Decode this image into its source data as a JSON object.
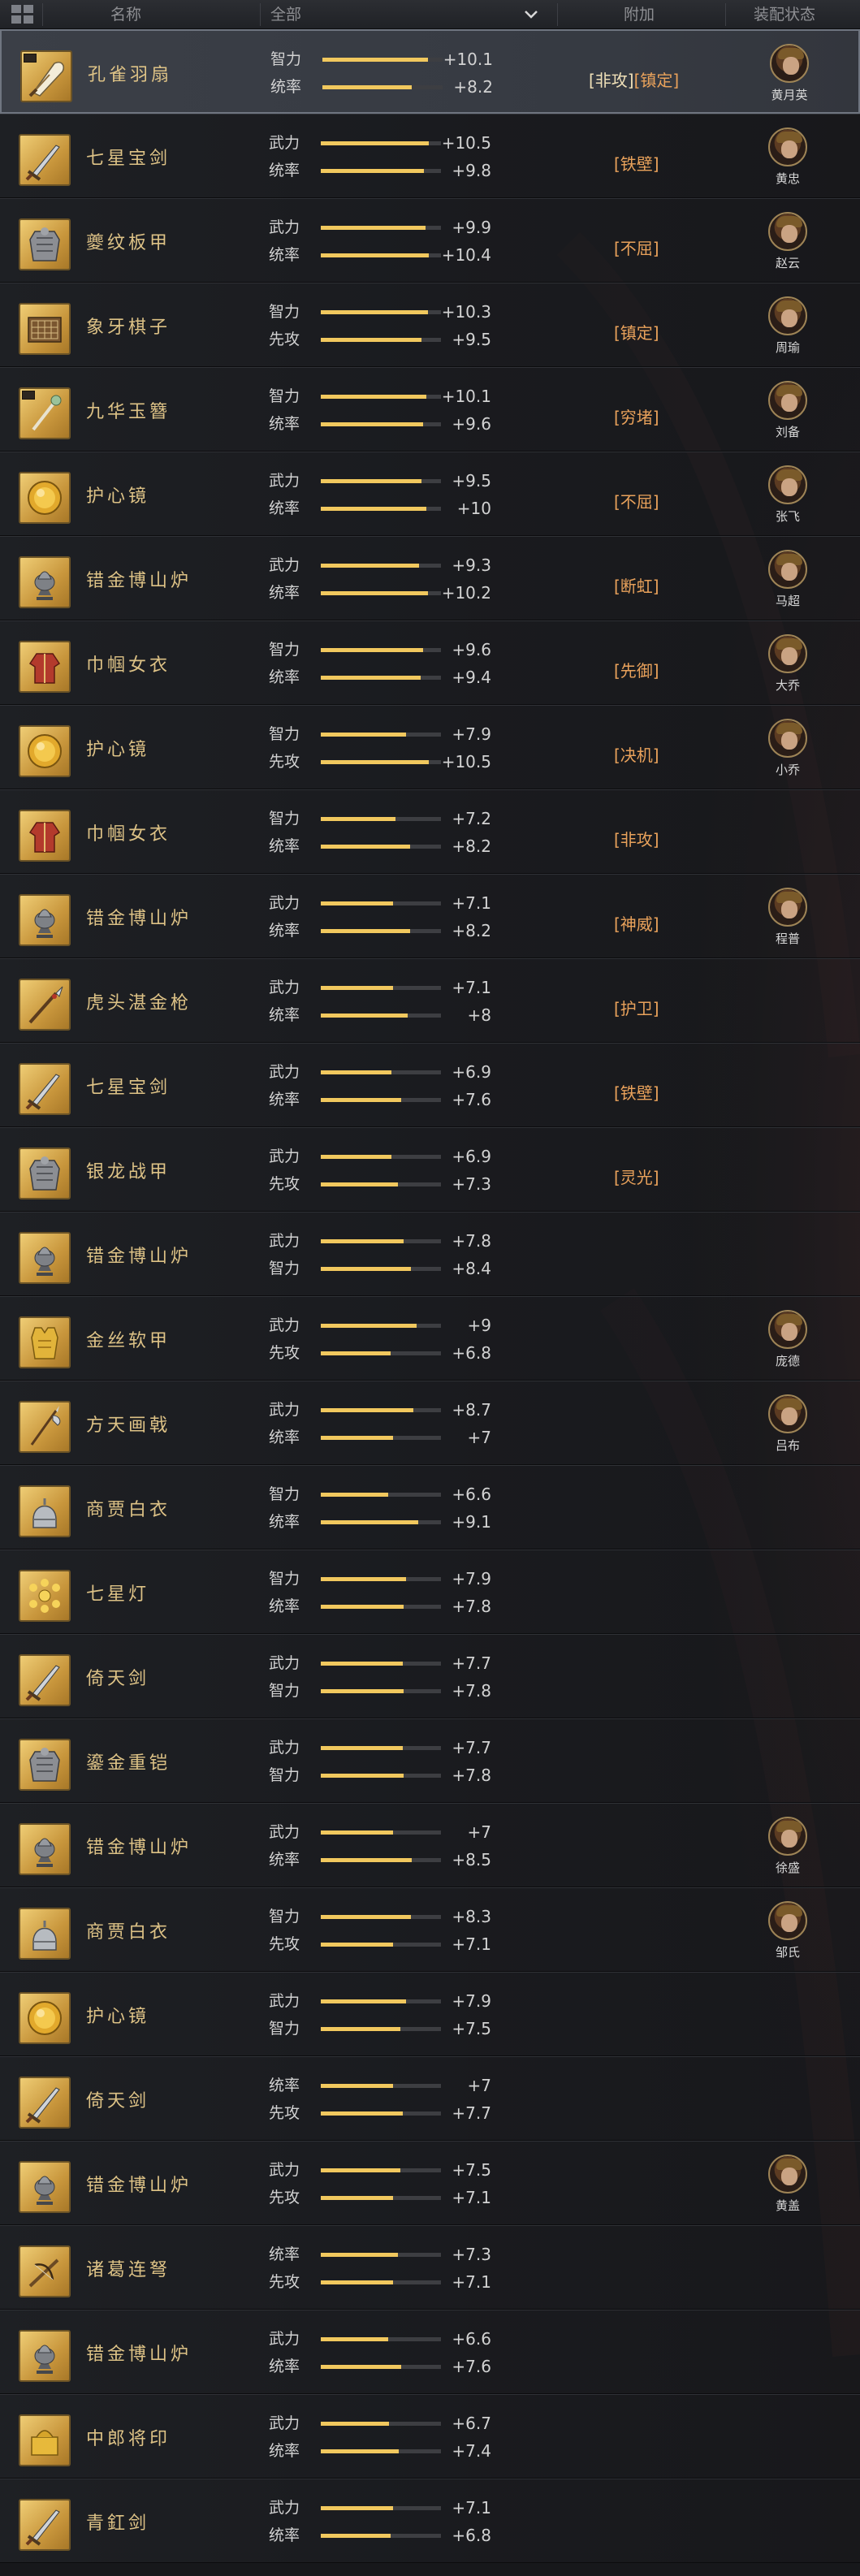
{
  "colors": {
    "bar_fill": "#f1c85e",
    "bar_track": "#3d3e42",
    "name_gold": "#ddc286",
    "extra_orange": "#e9a25b"
  },
  "header": {
    "menu_icon": "grid-icon",
    "name_col": "名称",
    "filter": "全部",
    "dropdown_icon": "chevron-down-icon",
    "extra_col": "附加",
    "equip_col": "装配状态"
  },
  "rows": [
    {
      "name": "孔雀羽扇",
      "icon": "feather-fan",
      "tagmark": true,
      "selected": true,
      "stats": [
        {
          "label": "智力",
          "value": "+10.1",
          "fill": 0.88
        },
        {
          "label": "统率",
          "value": "+8.2",
          "fill": 0.74
        }
      ],
      "extras": [
        "[非攻]",
        "[镇定]"
      ],
      "general": "黄月英"
    },
    {
      "name": "七星宝剑",
      "icon": "sword",
      "stats": [
        {
          "label": "武力",
          "value": "+10.5",
          "fill": 0.9
        },
        {
          "label": "统率",
          "value": "+9.8",
          "fill": 0.86
        }
      ],
      "extras": [
        "[铁壁]"
      ],
      "general": "黄忠"
    },
    {
      "name": "夔纹板甲",
      "icon": "armor",
      "stats": [
        {
          "label": "武力",
          "value": "+9.9",
          "fill": 0.87
        },
        {
          "label": "统率",
          "value": "+10.4",
          "fill": 0.9
        }
      ],
      "extras": [
        "[不屈]"
      ],
      "general": "赵云"
    },
    {
      "name": "象牙棋子",
      "icon": "board",
      "stats": [
        {
          "label": "智力",
          "value": "+10.3",
          "fill": 0.89
        },
        {
          "label": "先攻",
          "value": "+9.5",
          "fill": 0.84
        }
      ],
      "extras": [
        "[镇定]"
      ],
      "general": "周瑜"
    },
    {
      "name": "九华玉簪",
      "icon": "hairpin",
      "tagmark": true,
      "stats": [
        {
          "label": "智力",
          "value": "+10.1",
          "fill": 0.88
        },
        {
          "label": "统率",
          "value": "+9.6",
          "fill": 0.85
        }
      ],
      "extras": [
        "[穷堵]"
      ],
      "general": "刘备"
    },
    {
      "name": "护心镜",
      "icon": "mirror",
      "stats": [
        {
          "label": "武力",
          "value": "+9.5",
          "fill": 0.84
        },
        {
          "label": "统率",
          "value": "+10",
          "fill": 0.88
        }
      ],
      "extras": [
        "[不屈]"
      ],
      "general": "张飞"
    },
    {
      "name": "错金博山炉",
      "icon": "censer",
      "stats": [
        {
          "label": "武力",
          "value": "+9.3",
          "fill": 0.82
        },
        {
          "label": "统率",
          "value": "+10.2",
          "fill": 0.89
        }
      ],
      "extras": [
        "[断虹]"
      ],
      "general": "马超"
    },
    {
      "name": "巾帼女衣",
      "icon": "robe",
      "stats": [
        {
          "label": "智力",
          "value": "+9.6",
          "fill": 0.85
        },
        {
          "label": "统率",
          "value": "+9.4",
          "fill": 0.83
        }
      ],
      "extras": [
        "[先御]"
      ],
      "general": "大乔"
    },
    {
      "name": "护心镜",
      "icon": "mirror",
      "stats": [
        {
          "label": "智力",
          "value": "+7.9",
          "fill": 0.71
        },
        {
          "label": "先攻",
          "value": "+10.5",
          "fill": 0.9
        }
      ],
      "extras": [
        "[决机]"
      ],
      "general": "小乔"
    },
    {
      "name": "巾帼女衣",
      "icon": "robe",
      "stats": [
        {
          "label": "智力",
          "value": "+7.2",
          "fill": 0.62
        },
        {
          "label": "统率",
          "value": "+8.2",
          "fill": 0.74
        }
      ],
      "extras": [
        "[非攻]"
      ],
      "general": ""
    },
    {
      "name": "错金博山炉",
      "icon": "censer",
      "stats": [
        {
          "label": "武力",
          "value": "+7.1",
          "fill": 0.6
        },
        {
          "label": "统率",
          "value": "+8.2",
          "fill": 0.74
        }
      ],
      "extras": [
        "[神威]"
      ],
      "general": "程普"
    },
    {
      "name": "虎头湛金枪",
      "icon": "spear",
      "stats": [
        {
          "label": "武力",
          "value": "+7.1",
          "fill": 0.6
        },
        {
          "label": "统率",
          "value": "+8",
          "fill": 0.72
        }
      ],
      "extras": [
        "[护卫]"
      ],
      "general": ""
    },
    {
      "name": "七星宝剑",
      "icon": "sword",
      "stats": [
        {
          "label": "武力",
          "value": "+6.9",
          "fill": 0.59
        },
        {
          "label": "统率",
          "value": "+7.6",
          "fill": 0.67
        }
      ],
      "extras": [
        "[铁壁]"
      ],
      "general": ""
    },
    {
      "name": "银龙战甲",
      "icon": "armor",
      "stats": [
        {
          "label": "武力",
          "value": "+6.9",
          "fill": 0.59
        },
        {
          "label": "先攻",
          "value": "+7.3",
          "fill": 0.64
        }
      ],
      "extras": [
        "[灵光]"
      ],
      "general": ""
    },
    {
      "name": "错金博山炉",
      "icon": "censer",
      "stats": [
        {
          "label": "武力",
          "value": "+7.8",
          "fill": 0.69
        },
        {
          "label": "智力",
          "value": "+8.4",
          "fill": 0.75
        }
      ],
      "extras": [],
      "general": ""
    },
    {
      "name": "金丝软甲",
      "icon": "vest",
      "stats": [
        {
          "label": "武力",
          "value": "+9",
          "fill": 0.8
        },
        {
          "label": "先攻",
          "value": "+6.8",
          "fill": 0.58
        }
      ],
      "extras": [],
      "general": "庞德"
    },
    {
      "name": "方天画戟",
      "icon": "halberd",
      "stats": [
        {
          "label": "武力",
          "value": "+8.7",
          "fill": 0.77
        },
        {
          "label": "统率",
          "value": "+7",
          "fill": 0.6
        }
      ],
      "extras": [],
      "general": "吕布"
    },
    {
      "name": "商贾白衣",
      "icon": "helmet",
      "stats": [
        {
          "label": "智力",
          "value": "+6.6",
          "fill": 0.56
        },
        {
          "label": "统率",
          "value": "+9.1",
          "fill": 0.81
        }
      ],
      "extras": [],
      "general": ""
    },
    {
      "name": "七星灯",
      "icon": "lamp",
      "stats": [
        {
          "label": "智力",
          "value": "+7.9",
          "fill": 0.71
        },
        {
          "label": "统率",
          "value": "+7.8",
          "fill": 0.69
        }
      ],
      "extras": [],
      "general": ""
    },
    {
      "name": "倚天剑",
      "icon": "sword",
      "stats": [
        {
          "label": "武力",
          "value": "+7.7",
          "fill": 0.68
        },
        {
          "label": "智力",
          "value": "+7.8",
          "fill": 0.69
        }
      ],
      "extras": [],
      "general": ""
    },
    {
      "name": "鎏金重铠",
      "icon": "armor",
      "stats": [
        {
          "label": "武力",
          "value": "+7.7",
          "fill": 0.68
        },
        {
          "label": "智力",
          "value": "+7.8",
          "fill": 0.69
        }
      ],
      "extras": [],
      "general": ""
    },
    {
      "name": "错金博山炉",
      "icon": "censer",
      "stats": [
        {
          "label": "武力",
          "value": "+7",
          "fill": 0.6
        },
        {
          "label": "统率",
          "value": "+8.5",
          "fill": 0.76
        }
      ],
      "extras": [],
      "general": "徐盛"
    },
    {
      "name": "商贾白衣",
      "icon": "helmet",
      "stats": [
        {
          "label": "智力",
          "value": "+8.3",
          "fill": 0.75
        },
        {
          "label": "先攻",
          "value": "+7.1",
          "fill": 0.6
        }
      ],
      "extras": [],
      "general": "邹氏"
    },
    {
      "name": "护心镜",
      "icon": "mirror",
      "stats": [
        {
          "label": "武力",
          "value": "+7.9",
          "fill": 0.71
        },
        {
          "label": "智力",
          "value": "+7.5",
          "fill": 0.66
        }
      ],
      "extras": [],
      "general": ""
    },
    {
      "name": "倚天剑",
      "icon": "sword",
      "stats": [
        {
          "label": "统率",
          "value": "+7",
          "fill": 0.6
        },
        {
          "label": "先攻",
          "value": "+7.7",
          "fill": 0.68
        }
      ],
      "extras": [],
      "general": ""
    },
    {
      "name": "错金博山炉",
      "icon": "censer",
      "stats": [
        {
          "label": "武力",
          "value": "+7.5",
          "fill": 0.66
        },
        {
          "label": "先攻",
          "value": "+7.1",
          "fill": 0.6
        }
      ],
      "extras": [],
      "general": "黄盖"
    },
    {
      "name": "诸葛连弩",
      "icon": "crossbow",
      "stats": [
        {
          "label": "统率",
          "value": "+7.3",
          "fill": 0.64
        },
        {
          "label": "先攻",
          "value": "+7.1",
          "fill": 0.6
        }
      ],
      "extras": [],
      "general": ""
    },
    {
      "name": "错金博山炉",
      "icon": "censer",
      "stats": [
        {
          "label": "武力",
          "value": "+6.6",
          "fill": 0.56
        },
        {
          "label": "统率",
          "value": "+7.6",
          "fill": 0.67
        }
      ],
      "extras": [],
      "general": ""
    },
    {
      "name": "中郎将印",
      "icon": "seal",
      "stats": [
        {
          "label": "武力",
          "value": "+6.7",
          "fill": 0.57
        },
        {
          "label": "统率",
          "value": "+7.4",
          "fill": 0.65
        }
      ],
      "extras": [],
      "general": ""
    },
    {
      "name": "青釭剑",
      "icon": "sword",
      "stats": [
        {
          "label": "武力",
          "value": "+7.1",
          "fill": 0.6
        },
        {
          "label": "统率",
          "value": "+6.8",
          "fill": 0.58
        }
      ],
      "extras": [],
      "general": ""
    }
  ]
}
